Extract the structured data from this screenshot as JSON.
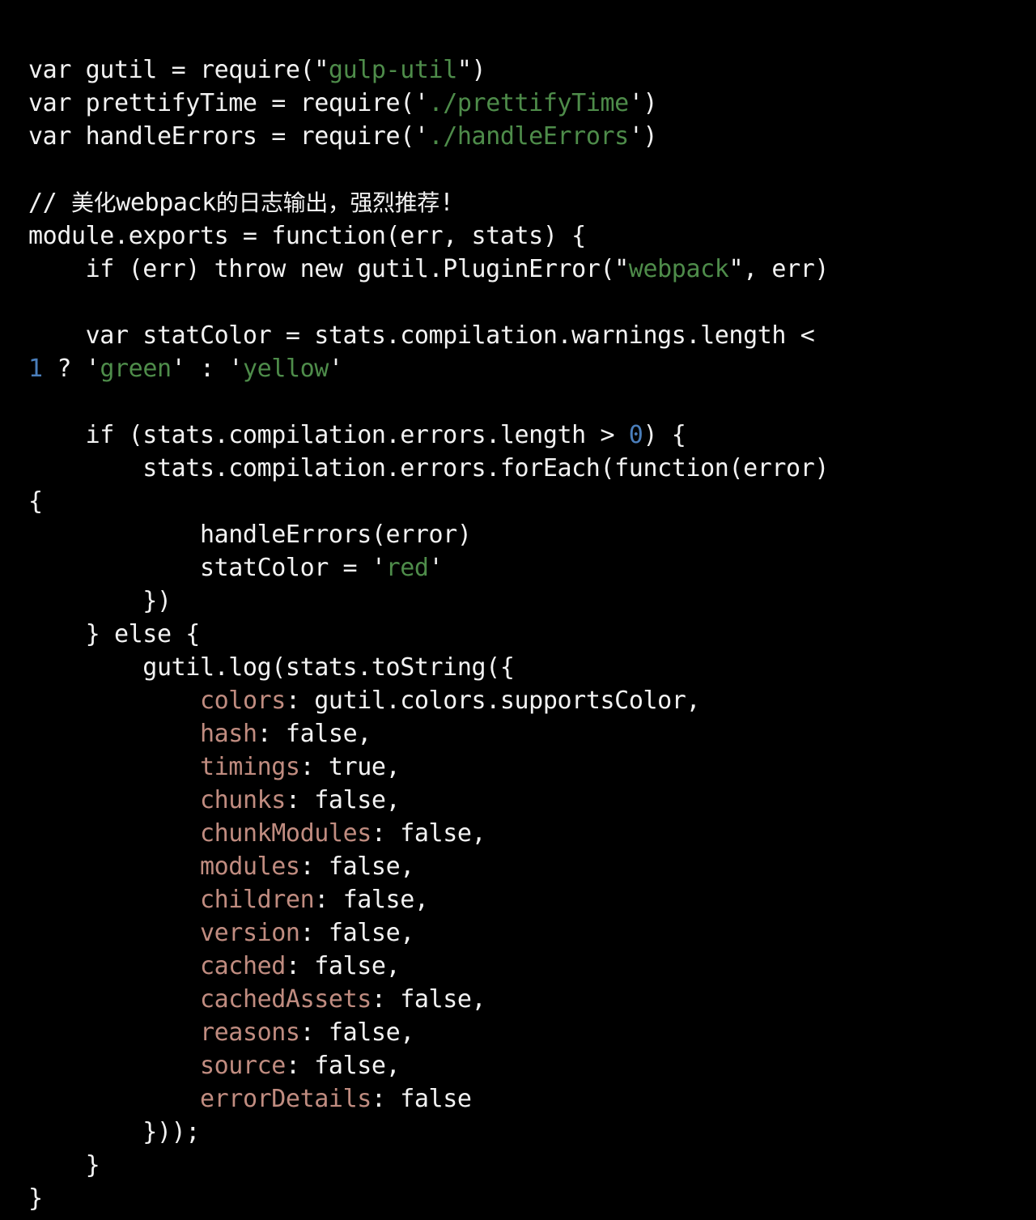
{
  "editor": {
    "background_color": "#000000",
    "foreground_color": "#f2f2f2",
    "string_color": "#4e8c4a",
    "number_color": "#4a7ebb",
    "property_key_color": "#c08c80",
    "language": "JavaScript",
    "font_size_px": 30,
    "line_height_px": 41
  },
  "code": {
    "lines": [
      {
        "id": "line-1",
        "tokens": [
          {
            "t": "var gutil = require(",
            "c": "plain"
          },
          {
            "t": "\"",
            "c": "punct"
          },
          {
            "t": "gulp-util",
            "c": "str"
          },
          {
            "t": "\"",
            "c": "punct"
          },
          {
            "t": ")",
            "c": "plain"
          }
        ]
      },
      {
        "id": "line-2",
        "tokens": [
          {
            "t": "var prettifyTime = require(",
            "c": "plain"
          },
          {
            "t": "'",
            "c": "punct"
          },
          {
            "t": "./prettifyTime",
            "c": "str"
          },
          {
            "t": "'",
            "c": "punct"
          },
          {
            "t": ")",
            "c": "plain"
          }
        ]
      },
      {
        "id": "line-3",
        "tokens": [
          {
            "t": "var handleErrors = require(",
            "c": "plain"
          },
          {
            "t": "'",
            "c": "punct"
          },
          {
            "t": "./handleErrors",
            "c": "str"
          },
          {
            "t": "'",
            "c": "punct"
          },
          {
            "t": ")",
            "c": "plain"
          }
        ]
      },
      {
        "id": "line-4",
        "blank": true,
        "tokens": []
      },
      {
        "id": "line-5",
        "tokens": [
          {
            "t": "// ",
            "c": "comment"
          },
          {
            "t": "美化",
            "c": "comment",
            "cjk": true
          },
          {
            "t": "webpack",
            "c": "comment"
          },
          {
            "t": "的日志输出，强烈推荐",
            "c": "comment",
            "cjk": true
          },
          {
            "t": "!",
            "c": "comment"
          }
        ]
      },
      {
        "id": "line-6",
        "tokens": [
          {
            "t": "module.exports = function(err, stats) {",
            "c": "plain"
          }
        ]
      },
      {
        "id": "line-7",
        "tokens": [
          {
            "t": "    if (err) throw new gutil.PluginError(",
            "c": "plain"
          },
          {
            "t": "\"",
            "c": "punct"
          },
          {
            "t": "webpack",
            "c": "str"
          },
          {
            "t": "\"",
            "c": "punct"
          },
          {
            "t": ", err)",
            "c": "plain"
          }
        ]
      },
      {
        "id": "line-8",
        "blank": true,
        "tokens": []
      },
      {
        "id": "line-9",
        "tokens": [
          {
            "t": "    var statColor = stats.compilation.warnings.length <",
            "c": "plain"
          }
        ]
      },
      {
        "id": "line-10",
        "wrapped": true,
        "tokens": [
          {
            "t": "1",
            "c": "num"
          },
          {
            "t": " ? ",
            "c": "plain"
          },
          {
            "t": "'",
            "c": "punct"
          },
          {
            "t": "green",
            "c": "str"
          },
          {
            "t": "'",
            "c": "punct"
          },
          {
            "t": " : ",
            "c": "plain"
          },
          {
            "t": "'",
            "c": "punct"
          },
          {
            "t": "yellow",
            "c": "str"
          },
          {
            "t": "'",
            "c": "punct"
          }
        ]
      },
      {
        "id": "line-11",
        "blank": true,
        "tokens": []
      },
      {
        "id": "line-12",
        "tokens": [
          {
            "t": "    if (stats.compilation.errors.length > ",
            "c": "plain"
          },
          {
            "t": "0",
            "c": "num"
          },
          {
            "t": ") {",
            "c": "plain"
          }
        ]
      },
      {
        "id": "line-13",
        "tokens": [
          {
            "t": "        stats.compilation.errors.forEach(function(error)",
            "c": "plain"
          }
        ]
      },
      {
        "id": "line-14",
        "wrapped": true,
        "tokens": [
          {
            "t": "{",
            "c": "plain"
          }
        ]
      },
      {
        "id": "line-15",
        "tokens": [
          {
            "t": "            handleErrors(error)",
            "c": "plain"
          }
        ]
      },
      {
        "id": "line-16",
        "tokens": [
          {
            "t": "            statColor = ",
            "c": "plain"
          },
          {
            "t": "'",
            "c": "punct"
          },
          {
            "t": "red",
            "c": "str"
          },
          {
            "t": "'",
            "c": "punct"
          }
        ]
      },
      {
        "id": "line-17",
        "tokens": [
          {
            "t": "        })",
            "c": "plain"
          }
        ]
      },
      {
        "id": "line-18",
        "tokens": [
          {
            "t": "    } else {",
            "c": "plain"
          }
        ]
      },
      {
        "id": "line-19",
        "tokens": [
          {
            "t": "        gutil.log(stats.toString({",
            "c": "plain"
          }
        ]
      },
      {
        "id": "line-20",
        "tokens": [
          {
            "t": "            ",
            "c": "plain"
          },
          {
            "t": "colors",
            "c": "key"
          },
          {
            "t": ": gutil.colors.supportsColor,",
            "c": "plain"
          }
        ]
      },
      {
        "id": "line-21",
        "tokens": [
          {
            "t": "            ",
            "c": "plain"
          },
          {
            "t": "hash",
            "c": "key"
          },
          {
            "t": ": false,",
            "c": "plain"
          }
        ]
      },
      {
        "id": "line-22",
        "tokens": [
          {
            "t": "            ",
            "c": "plain"
          },
          {
            "t": "timings",
            "c": "key"
          },
          {
            "t": ": true,",
            "c": "plain"
          }
        ]
      },
      {
        "id": "line-23",
        "tokens": [
          {
            "t": "            ",
            "c": "plain"
          },
          {
            "t": "chunks",
            "c": "key"
          },
          {
            "t": ": false,",
            "c": "plain"
          }
        ]
      },
      {
        "id": "line-24",
        "tokens": [
          {
            "t": "            ",
            "c": "plain"
          },
          {
            "t": "chunkModules",
            "c": "key"
          },
          {
            "t": ": false,",
            "c": "plain"
          }
        ]
      },
      {
        "id": "line-25",
        "tokens": [
          {
            "t": "            ",
            "c": "plain"
          },
          {
            "t": "modules",
            "c": "key"
          },
          {
            "t": ": false,",
            "c": "plain"
          }
        ]
      },
      {
        "id": "line-26",
        "tokens": [
          {
            "t": "            ",
            "c": "plain"
          },
          {
            "t": "children",
            "c": "key"
          },
          {
            "t": ": false,",
            "c": "plain"
          }
        ]
      },
      {
        "id": "line-27",
        "tokens": [
          {
            "t": "            ",
            "c": "plain"
          },
          {
            "t": "version",
            "c": "key"
          },
          {
            "t": ": false,",
            "c": "plain"
          }
        ]
      },
      {
        "id": "line-28",
        "tokens": [
          {
            "t": "            ",
            "c": "plain"
          },
          {
            "t": "cached",
            "c": "key"
          },
          {
            "t": ": false,",
            "c": "plain"
          }
        ]
      },
      {
        "id": "line-29",
        "tokens": [
          {
            "t": "            ",
            "c": "plain"
          },
          {
            "t": "cachedAssets",
            "c": "key"
          },
          {
            "t": ": false,",
            "c": "plain"
          }
        ]
      },
      {
        "id": "line-30",
        "tokens": [
          {
            "t": "            ",
            "c": "plain"
          },
          {
            "t": "reasons",
            "c": "key"
          },
          {
            "t": ": false,",
            "c": "plain"
          }
        ]
      },
      {
        "id": "line-31",
        "tokens": [
          {
            "t": "            ",
            "c": "plain"
          },
          {
            "t": "source",
            "c": "key"
          },
          {
            "t": ": false,",
            "c": "plain"
          }
        ]
      },
      {
        "id": "line-32",
        "tokens": [
          {
            "t": "            ",
            "c": "plain"
          },
          {
            "t": "errorDetails",
            "c": "key"
          },
          {
            "t": ": false",
            "c": "plain"
          }
        ]
      },
      {
        "id": "line-33",
        "tokens": [
          {
            "t": "        }));",
            "c": "plain"
          }
        ]
      },
      {
        "id": "line-34",
        "tokens": [
          {
            "t": "    }",
            "c": "plain"
          }
        ]
      },
      {
        "id": "line-35",
        "tokens": [
          {
            "t": "}",
            "c": "plain"
          }
        ]
      }
    ]
  }
}
